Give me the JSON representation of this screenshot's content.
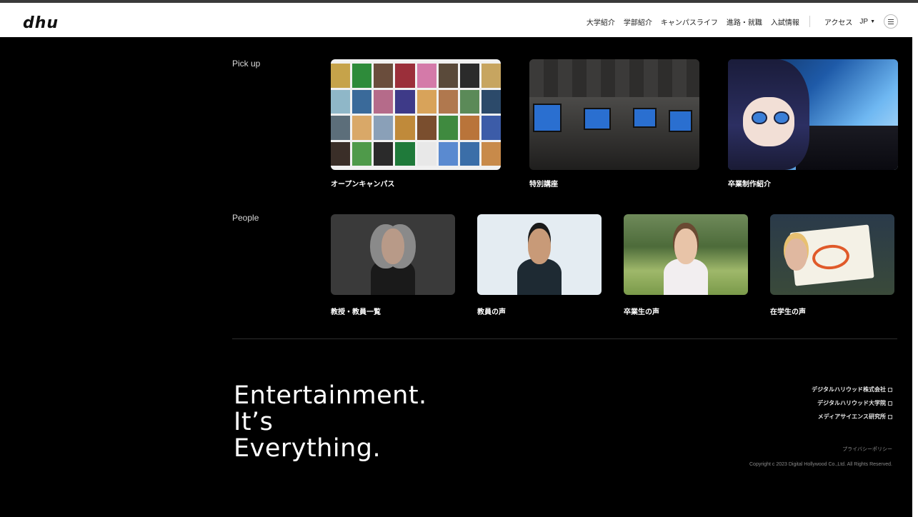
{
  "header": {
    "logo": "dhu",
    "nav": [
      "大学紹介",
      "学部紹介",
      "キャンパスライフ",
      "進路・就職",
      "入試情報"
    ],
    "access": "アクセス",
    "lang": "JP"
  },
  "pickup": {
    "label": "Pick up",
    "cards": [
      {
        "caption": "オープンキャンパス"
      },
      {
        "caption": "特別講座"
      },
      {
        "caption": "卒業制作紹介"
      }
    ]
  },
  "people": {
    "label": "People",
    "cards": [
      {
        "caption": "教授・教員一覧"
      },
      {
        "caption": "教員の声"
      },
      {
        "caption": "卒業生の声"
      },
      {
        "caption": "在学生の声"
      }
    ]
  },
  "footer": {
    "tagline": [
      "Entertainment.",
      "It’s",
      "Everything."
    ],
    "links": [
      "デジタルハリウッド株式会社",
      "デジタルハリウッド大学院",
      "メディアサイエンス研究所"
    ],
    "privacy": "プライバシーポリシー",
    "copyright": "Copyright c 2023 Digital Hollywood Co.,Ltd. All Rights Reserved."
  },
  "colors": {
    "background": "#000000",
    "header_bg": "#ffffff",
    "text": "#ffffff"
  }
}
